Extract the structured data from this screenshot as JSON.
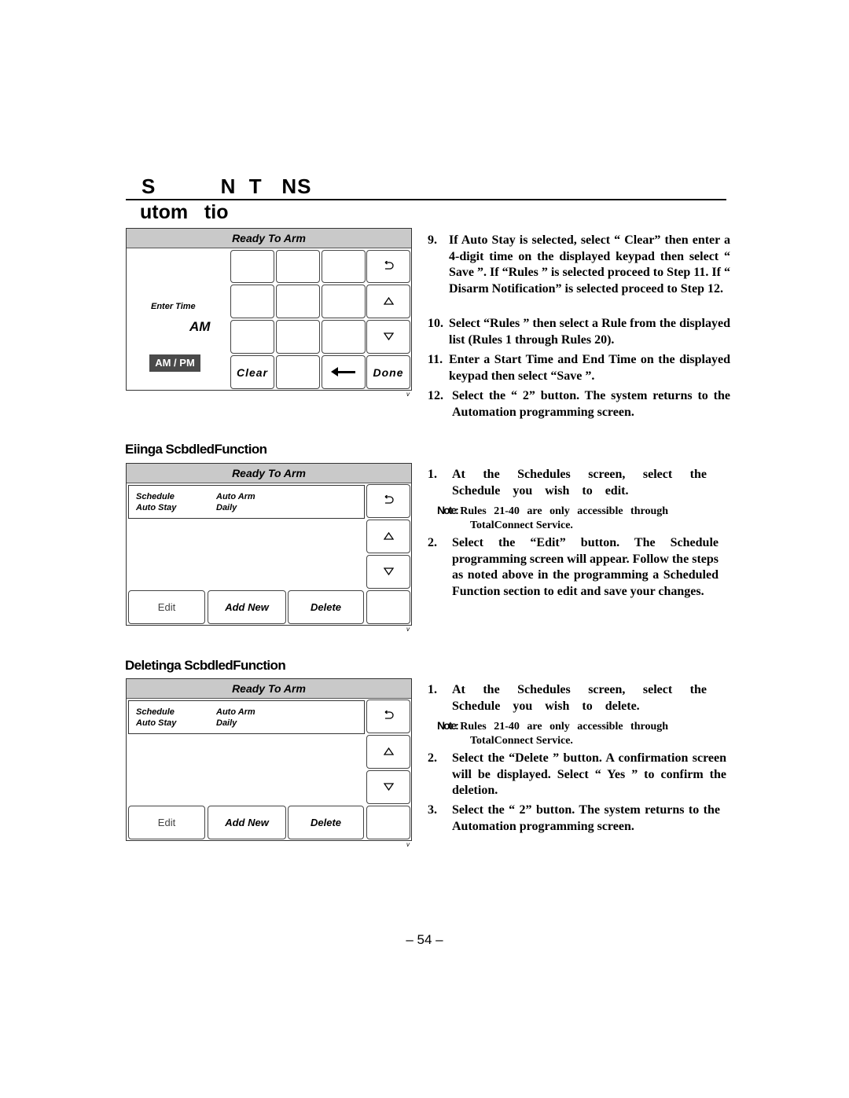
{
  "page": {
    "section_title": "S          N  T   NS",
    "subsection_title": "utom   tio",
    "page_number": "– 54 –"
  },
  "screen1": {
    "header": "Ready To Arm",
    "enter_time_label": "Enter Time",
    "am_value": "AM",
    "ampm_button": "AM / PM",
    "keys": {
      "clear": "Clear",
      "done": "Done",
      "back_icon": "return-icon",
      "up_icon": "up-triangle-icon",
      "down_icon": "down-triangle-icon",
      "backspace_icon": "left-arrow-icon"
    },
    "corner_mark": "v"
  },
  "steps_top": [
    {
      "num": "9.",
      "text": "If Auto Stay is selected, select “ Clear” then enter a 4-digit time on the displayed keypad then select “ Save ”. If “Rules ” is selected proceed to Step 11. If “ Disarm Notification” is selected proceed to Step 12."
    },
    {
      "num": "10.",
      "text": "Select “Rules ” then select a Rule from the displayed list (Rules 1 through Rules 20)."
    },
    {
      "num": "11.",
      "text": "Enter a Start Time and End Time on the displayed keypad then select “Save ”."
    },
    {
      "num": "12.",
      "text": "Select the “ 2” button. The system returns to the Automation programming screen."
    }
  ],
  "edit_section": {
    "heading": "Ediing a Schedled Function",
    "heading_render": "Eiinga ScbdledFunction",
    "screen": {
      "header": "Ready To Arm",
      "row": {
        "col1_line1": "Schedule",
        "col1_line2": "Auto Stay",
        "col2_line1": "Auto Arm",
        "col2_line2": "Daily"
      },
      "buttons": {
        "edit": "Edit",
        "add_new": "Add New",
        "delete": "Delete"
      },
      "corner_mark": "v"
    },
    "steps": [
      {
        "num": "1.",
        "text": "At the Schedules screen, select the Schedule you wish to edit."
      },
      {
        "num": "2.",
        "text": "Select the “Edit” button. The Schedule programming screen will appear. Follow the steps as noted above in the programming a Scheduled Function section to edit and save your changes."
      }
    ],
    "note": {
      "label": "Note:",
      "text": "Rules 21-40 are only accessible through",
      "text2": "TotalConnect Service."
    }
  },
  "delete_section": {
    "heading": "Deletinga ScbdledFunction",
    "screen": {
      "header": "Ready To Arm",
      "row": {
        "col1_line1": "Schedule",
        "col1_line2": "Auto Stay",
        "col2_line1": "Auto Arm",
        "col2_line2": "Daily"
      },
      "buttons": {
        "edit": "Edit",
        "add_new": "Add New",
        "delete": "Delete"
      },
      "corner_mark": "v"
    },
    "steps": [
      {
        "num": "1.",
        "text": "At the Schedules screen, select the Schedule you wish to delete."
      },
      {
        "num": "2.",
        "text": "Select the “Delete ” button. A confirmation screen will be displayed. Select “ Yes ” to confirm the deletion."
      },
      {
        "num": "3.",
        "text": "Select the “ 2” button. The system returns to the Automation programming screen."
      }
    ],
    "note": {
      "label": "Note:",
      "text": "Rules 21-40 are only accessible through",
      "text2": "TotalConnect Service."
    }
  }
}
